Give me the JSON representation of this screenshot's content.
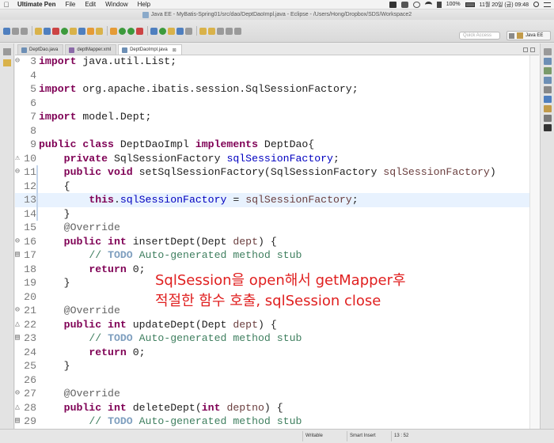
{
  "menubar": {
    "app_name": "Ultimate Pen",
    "items": [
      "File",
      "Edit",
      "Window",
      "Help"
    ],
    "battery": "100%",
    "clock": "11월 20일 (금)  09:48"
  },
  "window": {
    "title": "Java EE - MyBatis-Spring01/src/dao/DeptDaoImpl.java - Eclipse - /Users/Hong/Dropbox/SDS/Workspace2"
  },
  "toolbar": {
    "quick_access_placeholder": "Quick Access",
    "perspective_label": "Java EE"
  },
  "tabs": [
    {
      "label": "DeptDao.java",
      "active": false
    },
    {
      "label": "deptMapper.xml",
      "active": false
    },
    {
      "label": "DeptDaoImpl.java",
      "active": true,
      "close": "⊠"
    }
  ],
  "editor": {
    "lines": [
      {
        "n": "3",
        "mark": "⊖",
        "code": "<span class=\"kw\">import</span> java.util.List;"
      },
      {
        "n": "4",
        "mark": "",
        "code": ""
      },
      {
        "n": "5",
        "mark": "",
        "code": "<span class=\"kw\">import</span> org.apache.ibatis.session.SqlSessionFactory;"
      },
      {
        "n": "6",
        "mark": "",
        "code": ""
      },
      {
        "n": "7",
        "mark": "",
        "code": "<span class=\"kw\">import</span> model.Dept;"
      },
      {
        "n": "8",
        "mark": "",
        "code": ""
      },
      {
        "n": "9",
        "mark": "",
        "code": "<span class=\"kw\">public class</span> DeptDaoImpl <span class=\"kw\">implements</span> DeptDao{"
      },
      {
        "n": "10",
        "mark": "⚠",
        "code": "    <span class=\"kw\">private</span> SqlSessionFactory <span class=\"fld\">sqlSessionFactory</span>;"
      },
      {
        "n": "11",
        "mark": "⊖",
        "code": "    <span class=\"kw\">public void</span> setSqlSessionFactory(SqlSessionFactory <span class=\"prm\">sqlSessionFactory</span>)"
      },
      {
        "n": "12",
        "mark": "",
        "code": "    {"
      },
      {
        "n": "13",
        "mark": "",
        "code": "        <span class=\"kw\">this</span>.<span class=\"fld\">sqlSessionFactory</span> = <span class=\"prm\">sqlSessionFactory</span>;",
        "current": true
      },
      {
        "n": "14",
        "mark": "",
        "code": "    }"
      },
      {
        "n": "15",
        "mark": "",
        "code": "    <span class=\"ann\">@Override</span>"
      },
      {
        "n": "16",
        "mark": "⊖",
        "code": "    <span class=\"kw\">public int</span> insertDept(Dept <span class=\"prm\">dept</span>) {"
      },
      {
        "n": "17",
        "mark": "▤",
        "code": "        <span class=\"cmt\">// <span class=\"todo\">TODO</span> Auto-generated method stub</span>"
      },
      {
        "n": "18",
        "mark": "",
        "code": "        <span class=\"kw\">return</span> 0;"
      },
      {
        "n": "19",
        "mark": "",
        "code": "    }"
      },
      {
        "n": "20",
        "mark": "",
        "code": ""
      },
      {
        "n": "21",
        "mark": "⊖",
        "code": "    <span class=\"ann\">@Override</span>"
      },
      {
        "n": "22",
        "mark": "△",
        "code": "    <span class=\"kw\">public int</span> updateDept(Dept <span class=\"prm\">dept</span>) {"
      },
      {
        "n": "23",
        "mark": "▤",
        "code": "        <span class=\"cmt\">// <span class=\"todo\">TODO</span> Auto-generated method stub</span>"
      },
      {
        "n": "24",
        "mark": "",
        "code": "        <span class=\"kw\">return</span> 0;"
      },
      {
        "n": "25",
        "mark": "",
        "code": "    }"
      },
      {
        "n": "26",
        "mark": "",
        "code": ""
      },
      {
        "n": "27",
        "mark": "⊖",
        "code": "    <span class=\"ann\">@Override</span>"
      },
      {
        "n": "28",
        "mark": "△",
        "code": "    <span class=\"kw\">public int</span> deleteDept(<span class=\"kw\">int</span> <span class=\"prm\">deptno</span>) {"
      },
      {
        "n": "29",
        "mark": "▤",
        "code": "        <span class=\"cmt\">// <span class=\"todo\">TODO</span> Auto-generated method stub</span>"
      }
    ]
  },
  "annotation": {
    "line1": "SqlSession을 open해서 getMapper후",
    "line2": "적절한 함수 호출, sqlSession close",
    "color": "#e02020"
  },
  "status": {
    "writable": "Writable",
    "insert_mode": "Smart Insert",
    "position": "13 : 52"
  }
}
